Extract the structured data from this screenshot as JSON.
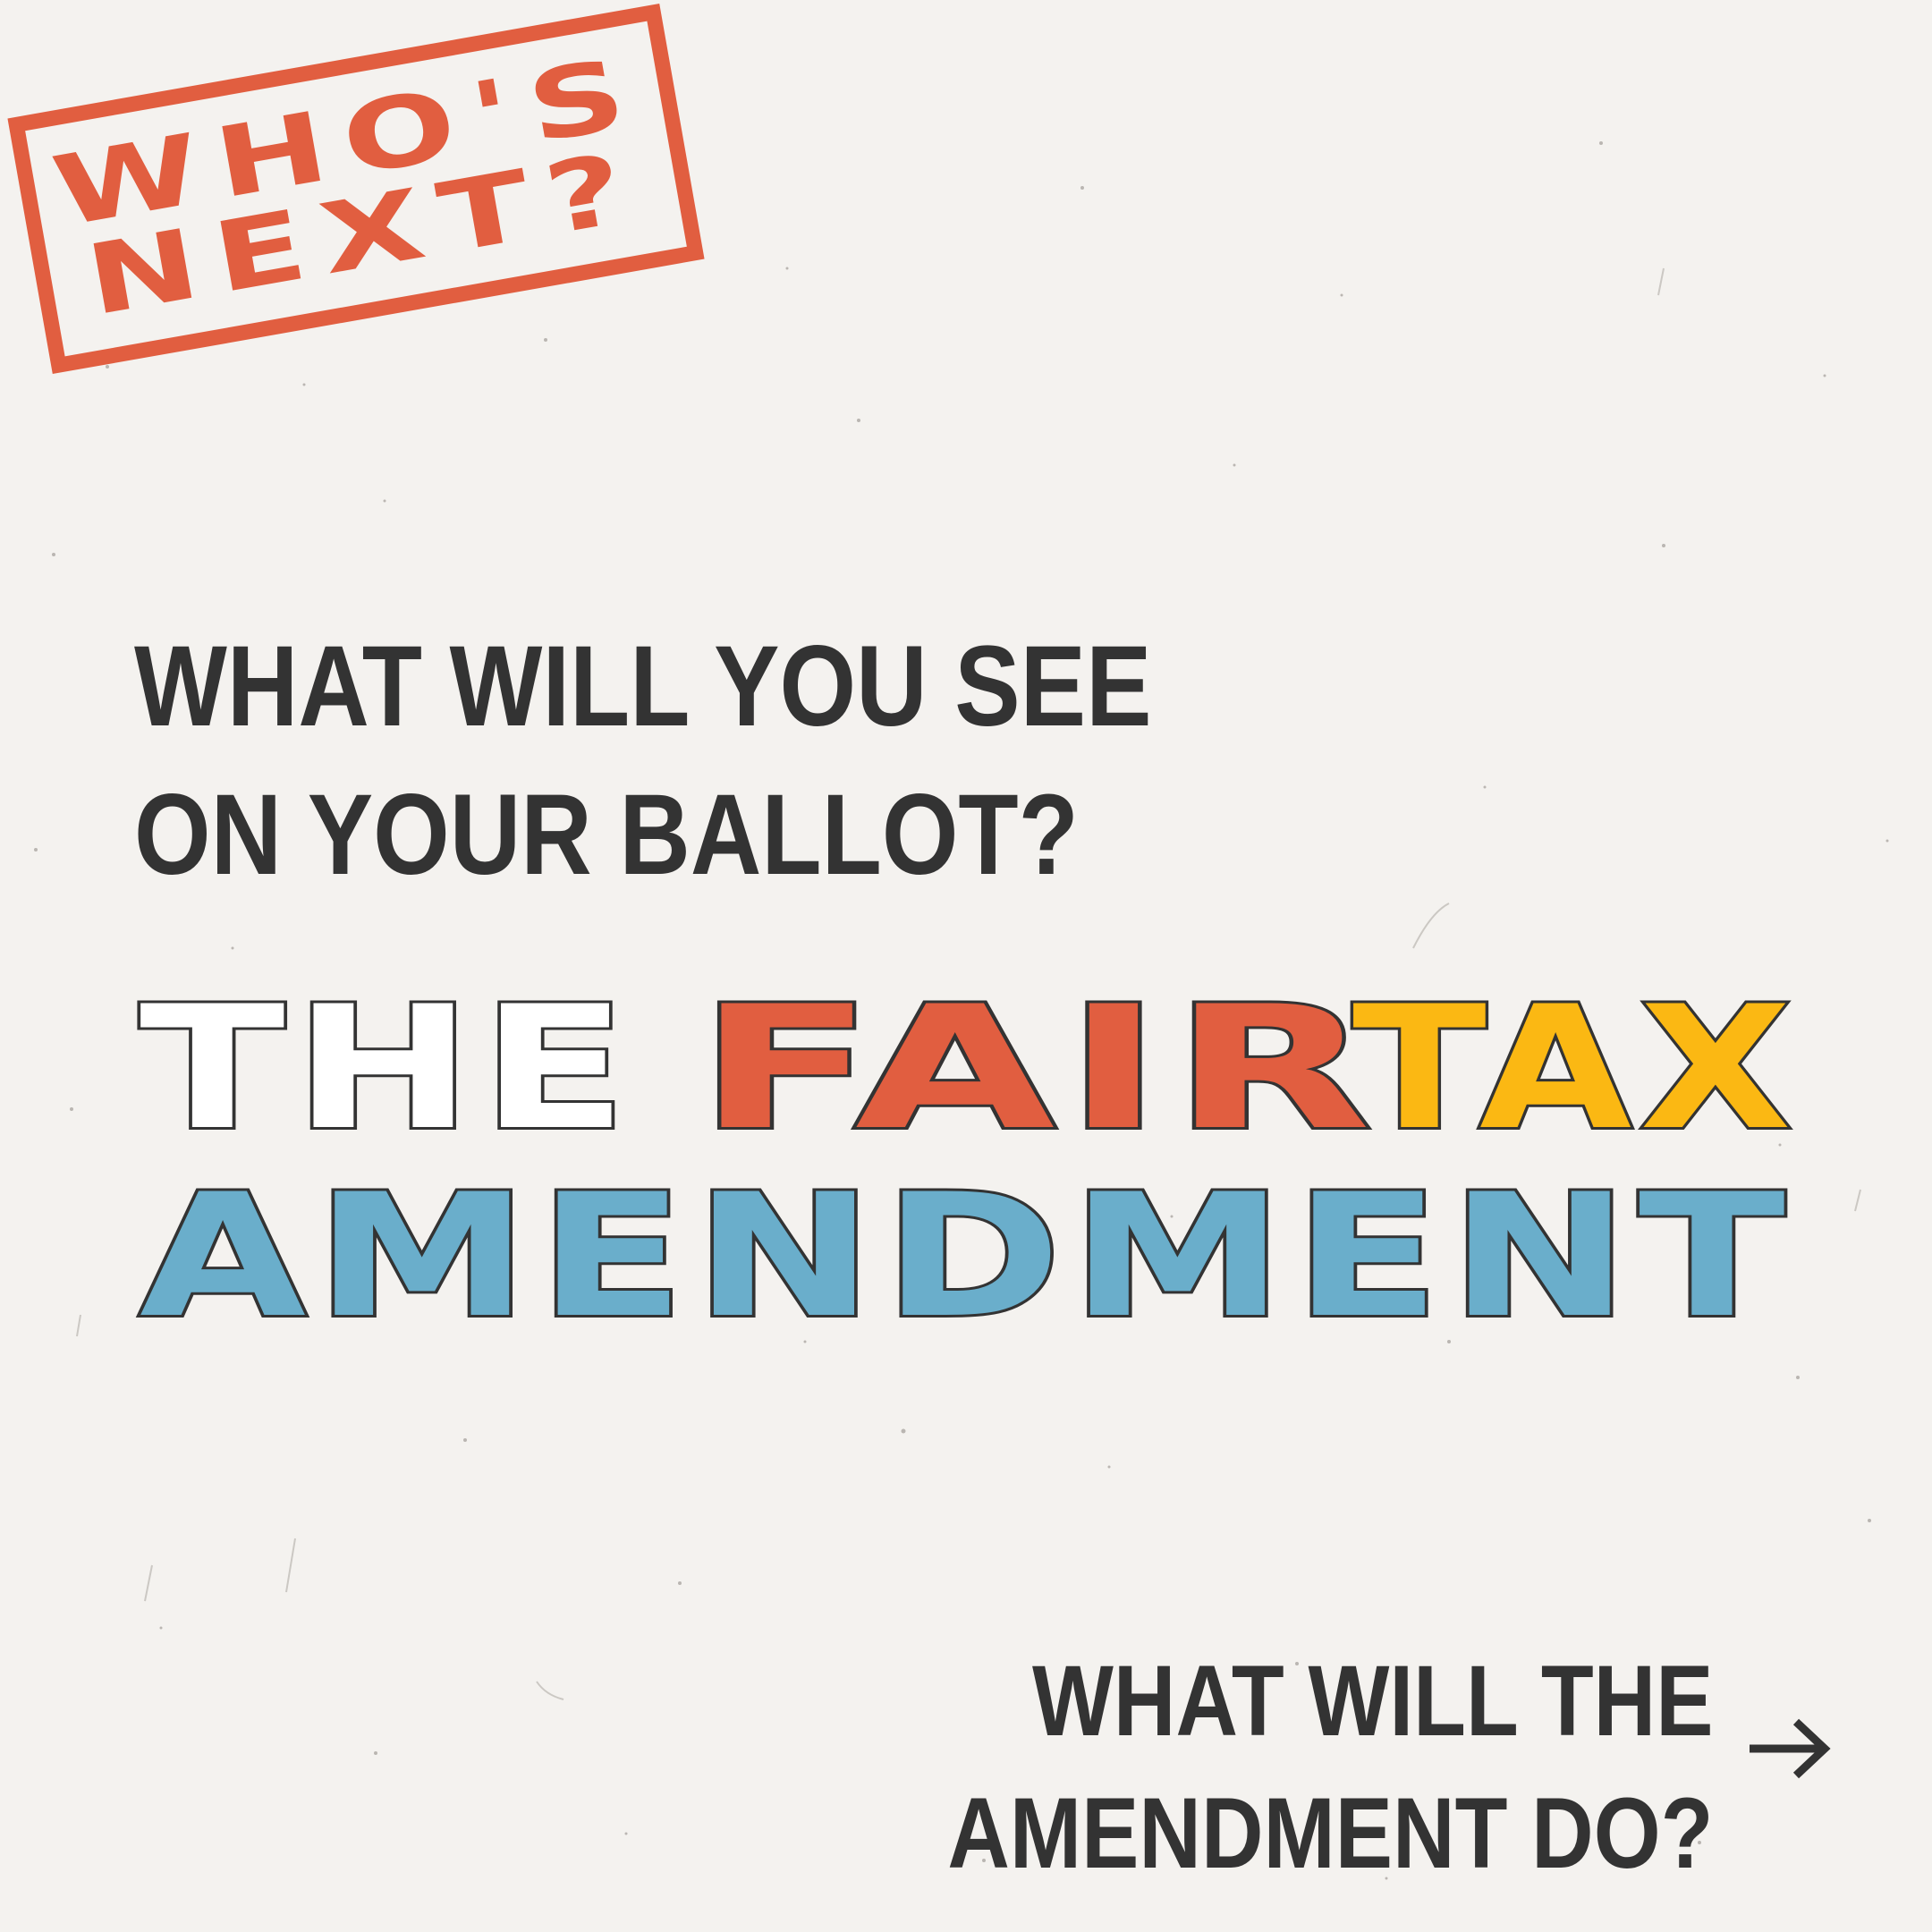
{
  "stamp": {
    "line1": "WHO'S",
    "line2": "NEXT?",
    "color": "#e15e40"
  },
  "question": {
    "line1": "WHAT WILL YOU SEE",
    "line2": "ON YOUR BALLOT?"
  },
  "headline": {
    "word_the": "THE",
    "word_fair": "FAIR",
    "word_tax": "TAX",
    "word_amendment": "AMENDMENT",
    "colors": {
      "the": "#ffffff",
      "fair": "#e15e40",
      "tax": "#fbb813",
      "amendment": "#6aaecb",
      "outline": "#333333"
    }
  },
  "next_prompt": {
    "line1": "WHAT WILL THE",
    "line2": "AMENDMENT DO?",
    "icon": "arrow-right-icon"
  },
  "colors": {
    "background": "#f4f2ef",
    "text": "#333333"
  }
}
